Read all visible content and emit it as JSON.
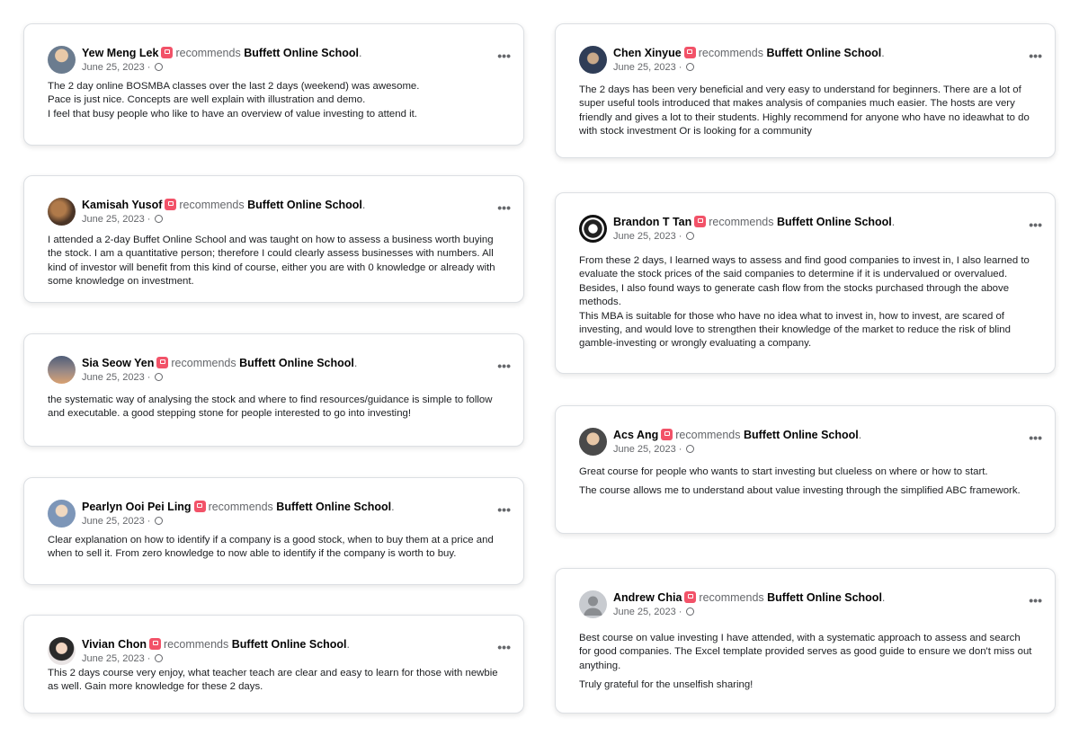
{
  "recommend_word": "recommends",
  "page_name": "Buffett Online School",
  "page_name_suffix": ".",
  "more_glyph": "•••",
  "reviews": [
    {
      "name": "Yew Meng Lek",
      "date": "June 25, 2023 ·",
      "paragraphs": [
        "The 2 day online BOSMBA classes over the last 2 days (weekend) was awesome.\nPace is just nice. Concepts are well explain with illustration and demo.\nI feel that busy people who like to have an overview of value investing to attend it."
      ]
    },
    {
      "name": "Kamisah Yusof",
      "date": "June 25, 2023 ·",
      "paragraphs": [
        "I attended a 2-day Buffet Online School and was taught on how to assess a business worth buying the stock. I am a quantitative person; therefore I could clearly assess businesses with numbers. All kind of investor will benefit from this kind of course, either you are with 0 knowledge or already with some knowledge on investment."
      ]
    },
    {
      "name": "Sia Seow Yen",
      "date": "June 25, 2023 ·",
      "paragraphs": [
        "the systematic way of analysing the stock and where to find resources/guidance is simple to follow and executable. a good stepping stone for people interested to go into investing!"
      ]
    },
    {
      "name": "Pearlyn Ooi Pei Ling",
      "date": "June 25, 2023 ·",
      "paragraphs": [
        "Clear explanation on how to identify if a company is a good stock, when to buy them at a price and when to sell it. From zero knowledge to now able to identify if the company is worth to buy."
      ]
    },
    {
      "name": "Vivian Chon",
      "date": "June 25, 2023 ·",
      "paragraphs": [
        "This 2 days course very enjoy, what teacher teach are clear and easy to learn for those with newbie as well. Gain more knowledge for these 2 days."
      ]
    },
    {
      "name": "Chen Xinyue",
      "date": "June 25, 2023 ·",
      "paragraphs": [
        "The 2 days has been very beneficial and very easy to understand for beginners. There are a lot of super useful tools introduced that makes analysis of companies much easier. The hosts are very friendly and gives a lot to their students. Highly recommend for anyone who have no ideawhat to do with stock investment Or is looking for a community"
      ]
    },
    {
      "name": "Brandon T Tan",
      "date": "June 25, 2023 ·",
      "paragraphs": [
        "From these 2 days, I learned ways to assess and find good companies to invest in, I also learned to evaluate the stock prices of the said companies to determine if it is undervalued or overvalued. Besides, I also found ways to generate cash flow from the stocks purchased through the above methods.\nThis MBA is suitable for those who have no idea what to invest in, how to invest, are scared of investing, and would love to strengthen their knowledge of the market to reduce the risk of blind gamble-investing or wrongly evaluating a company."
      ]
    },
    {
      "name": "Acs Ang",
      "date": "June 25, 2023 ·",
      "paragraphs": [
        "Great course for people who wants to start investing but clueless on where or how to start.",
        "The course allows me to understand about value investing through the simplified ABC framework."
      ]
    },
    {
      "name": "Andrew Chia",
      "date": "June 25, 2023 ·",
      "paragraphs": [
        "Best course on value investing I have attended, with a systematic approach to assess and search for good companies. The Excel template provided serves as good guide to ensure we don't miss out anything.",
        "Truly grateful for the unselfish sharing!"
      ]
    }
  ]
}
